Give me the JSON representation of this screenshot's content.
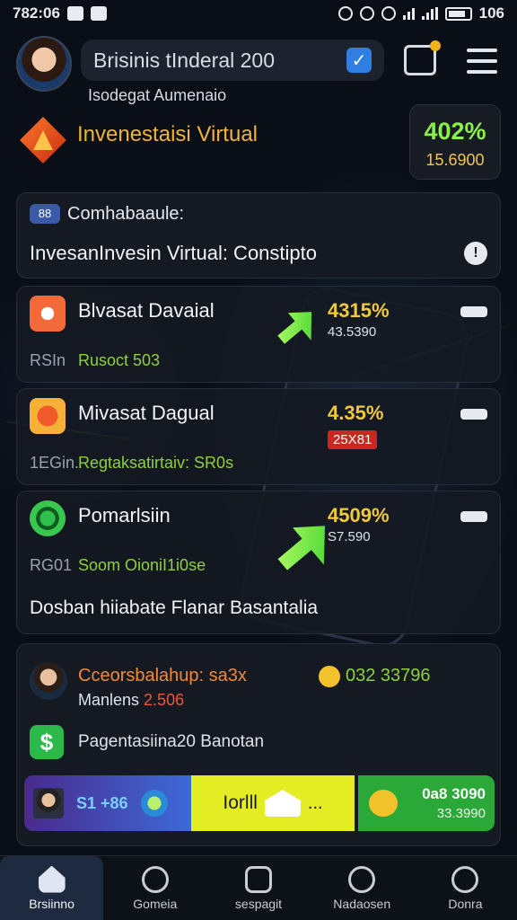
{
  "status_bar": {
    "time": "782:06",
    "battery_text": "106"
  },
  "header": {
    "search_text": "Brisinis tInderal 200",
    "subtitle": "Isodegat Aumenaio"
  },
  "hero": {
    "title": "Invenestaisi Virtual",
    "stat_percent": "402%",
    "stat_value": "15.6900"
  },
  "top_card": {
    "tag_icon_text": "88",
    "tag_label": "Comhabaaule:",
    "title": "InvesanInvesin Virtual: Constipto"
  },
  "items": [
    {
      "name": "Blvasat Davaial",
      "code": "RSIn",
      "sub": "Rusoct 503",
      "percent": "4315%",
      "value": "43.5390"
    },
    {
      "name": "Mivasat Dagual",
      "code": "1EGin.",
      "sub": "Regtaksatirtaiv: SR0s",
      "percent": "4.35%",
      "value": "25X81"
    },
    {
      "name": "Pomarlsiin",
      "code": "RG01",
      "sub": "Soom OioniI1i0se",
      "percent": "4509%",
      "value": "S7.590"
    }
  ],
  "footer_line": "Dosban hiiabate Flanar Basantalia",
  "bottom_card": {
    "person_name": "Cceorsbalahup: sa3x",
    "coin_value": "032 33796",
    "person_meta_prefix": "Manlens ",
    "person_meta_red": "2.506",
    "dollar_label": "Pagentasiina20 Banotan",
    "btn1_text": "S1 +86",
    "btn2_text": "Iorlll",
    "btn2_dots": "...",
    "btn3_value1": "0a8 3090",
    "btn3_value2": "33.3990"
  },
  "nav": [
    {
      "label": "Brsiinno"
    },
    {
      "label": "Gomeia"
    },
    {
      "label": "sespagit"
    },
    {
      "label": "Nadaosen"
    },
    {
      "label": "Donra"
    }
  ],
  "colors": {
    "accent_green": "#8cf04a",
    "accent_gold": "#f2c93a",
    "accent_orange": "#f0b43a",
    "background": "#0a0e16"
  }
}
